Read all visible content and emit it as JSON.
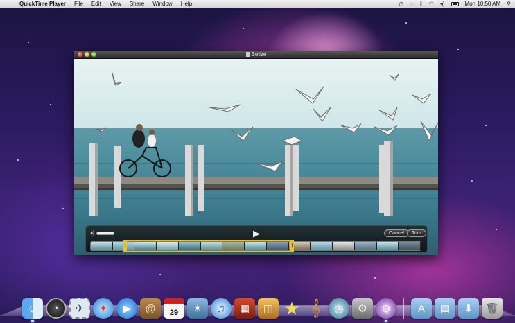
{
  "menubar": {
    "app_name": "QuickTime Player",
    "menus": [
      "File",
      "Edit",
      "View",
      "Share",
      "Window",
      "Help"
    ],
    "clock": "Mon 10:50 AM",
    "status_icons": [
      "time-machine-icon",
      "sync-icon",
      "bluetooth-icon",
      "wifi-icon",
      "volume-icon",
      "battery-icon"
    ]
  },
  "player": {
    "title": "Belize",
    "cancel_label": "Cancel",
    "trim_label": "Trim"
  },
  "colors": {
    "trim_selection": "#e3c227",
    "sea": "#3d7d8e",
    "sky": "#d9ecee"
  },
  "dock": {
    "icons": [
      "finder-icon",
      "dashboard-icon",
      "mail-stamp-icon",
      "safari-icon",
      "ichat-icon",
      "address-book-icon",
      "ical-icon",
      "iphoto-icon",
      "itunes-icon",
      "imovie-icon",
      "preview-icon",
      "imovie-star-icon",
      "garageband-icon",
      "time-machine-icon",
      "system-preferences-icon",
      "quicktime-icon",
      "applications-folder-icon",
      "documents-folder-icon",
      "downloads-folder-icon",
      "trash-icon"
    ],
    "calendar_day": "29"
  }
}
